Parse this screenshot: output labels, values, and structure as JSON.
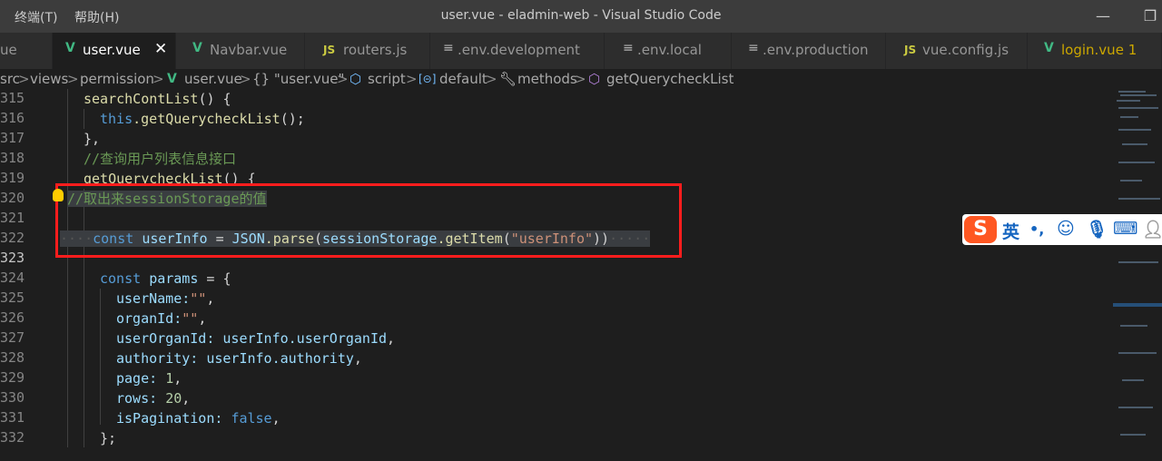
{
  "window": {
    "menu": [
      "终端(T)",
      "帮助(H)"
    ],
    "title": "user.vue - eladmin-web - Visual Studio Code",
    "min_icon": "minimize-icon",
    "max_icon": "restore-icon"
  },
  "tabs": [
    {
      "label": "ue",
      "icon": "vue-icon",
      "active": false
    },
    {
      "label": "user.vue",
      "icon": "vue-icon",
      "active": true,
      "close": "✕"
    },
    {
      "label": "Navbar.vue",
      "icon": "vue-icon",
      "active": false
    },
    {
      "label": "routers.js",
      "icon": "js-icon",
      "active": false
    },
    {
      "label": ".env.development",
      "icon": "file-lines-icon",
      "active": false
    },
    {
      "label": ".env.local",
      "icon": "file-lines-icon",
      "active": false
    },
    {
      "label": ".env.production",
      "icon": "file-lines-icon",
      "active": false
    },
    {
      "label": "vue.config.js",
      "icon": "js-icon",
      "active": false
    },
    {
      "label": "login.vue 1",
      "icon": "vue-icon",
      "active": false,
      "modified": true,
      "color": "#cca700"
    }
  ],
  "breadcrumbs": [
    "src",
    "views",
    "permission",
    "user.vue",
    "{} \"user.vue\"",
    "script",
    "default",
    "methods",
    "getQuerycheckList"
  ],
  "editor": {
    "line_numbers": [
      "315",
      "316",
      "317",
      "318",
      "319",
      "320",
      "321",
      "322",
      "323",
      "324",
      "325",
      "326",
      "327",
      "328",
      "329",
      "330",
      "331",
      "332"
    ],
    "current_line": "323",
    "lines": {
      "l315_fn": "searchContList",
      "l315_rest": "() {",
      "l316_this": "this",
      "l316_fn": ".getQuerycheckList",
      "l316_rest": "();",
      "l317": "},",
      "l318": "//查询用户列表信息接口",
      "l319_fn": "getQuerycheckList",
      "l319_rest": "() {",
      "l320": "//取出来sessionStorage的值",
      "l322_const": "const",
      "l322_var": "userInfo",
      "l322_eq": " = ",
      "l322_json": "JSON",
      "l322_parse": ".parse",
      "l322_p1": "(",
      "l322_ss": "sessionStorage",
      "l322_getitem": ".getItem",
      "l322_p2": "(",
      "l322_str": "\"userInfo\"",
      "l322_p3": "))",
      "l324_const": "const",
      "l324_var": "params",
      "l324_rest": " = {",
      "l325_key": "userName:",
      "l325_val": "\"\"",
      "l325_end": ",",
      "l326_key": "organId:",
      "l326_val": "\"\"",
      "l326_end": ",",
      "l327_key": "userOrganId: ",
      "l327_obj": "userInfo",
      "l327_prop": ".userOrganId",
      "l327_end": ",",
      "l328_key": "authority: ",
      "l328_obj": "userInfo",
      "l328_prop": ".authority",
      "l328_end": ",",
      "l329_key": "page: ",
      "l329_val": "1",
      "l329_end": ",",
      "l330_key": "rows: ",
      "l330_val": "20",
      "l330_end": ",",
      "l331_key": "isPagination: ",
      "l331_val": "false",
      "l331_end": ",",
      "l332": "};"
    }
  },
  "ime_toolbar": {
    "logo": "S",
    "mode": "英",
    "punct": "•,",
    "icons": [
      "smiley-icon",
      "microphone-icon",
      "keyboard-icon",
      "user-icon"
    ]
  },
  "colors": {
    "highlight_box": "#ff1d1d",
    "editor_bg": "#1e1e1e",
    "tab_bar": "#252526",
    "title_bar": "#3c3c3c"
  }
}
